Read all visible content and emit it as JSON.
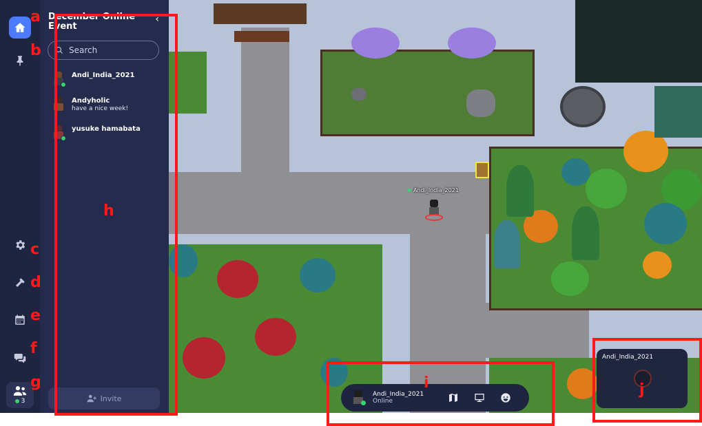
{
  "space": {
    "title": "December Online Event",
    "collapse_glyph": "‹"
  },
  "search": {
    "placeholder": "Search"
  },
  "members": [
    {
      "name": "Andi_India_2021",
      "status": ""
    },
    {
      "name": "Andyholic",
      "status": "have a nice week!"
    },
    {
      "name": "yusuke hamabata",
      "status": ""
    }
  ],
  "invite": {
    "label": "Invite"
  },
  "online_count": "3",
  "world_player": {
    "label": "Andi_India_2021"
  },
  "toolbar": {
    "user_name": "Andi_India_2021",
    "user_status": "Online",
    "icons": [
      "map-icon",
      "screen-share-icon",
      "emoji-icon"
    ]
  },
  "self_view": {
    "name": "Andi_India_2021"
  },
  "rail": {
    "icons": [
      "home-icon",
      "pin-icon",
      "gear-icon",
      "build-hammer-icon",
      "calendar-icon",
      "chat-icon",
      "users-icon"
    ]
  },
  "annotations": {
    "a": "a",
    "b": "b",
    "c": "c",
    "d": "d",
    "e": "e",
    "f": "f",
    "g": "g",
    "h": "h",
    "i": "i",
    "j": "j"
  },
  "colors": {
    "accent": "#4d7bff",
    "rail_bg": "#1f2440",
    "panel_bg": "#252b4c",
    "online": "#3bd16f",
    "annotation": "#ff1a1a"
  }
}
